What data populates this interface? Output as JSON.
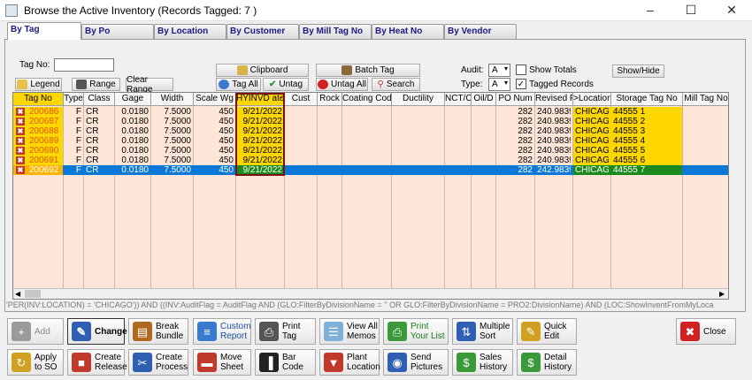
{
  "window": {
    "title": "Browse the Active Inventory  (Records Tagged:  7 )"
  },
  "tabs": [
    "By Tag",
    "By Po",
    "By Location",
    "By Customer",
    "By Mill Tag No",
    "By Heat No",
    "By Vendor"
  ],
  "filters": {
    "tag_no_label": "Tag No:",
    "tag_no_value": "",
    "legend": "Legend",
    "range": "Range",
    "clear_range": "Clear Range",
    "clipboard": "Clipboard",
    "batch_tag": "Batch Tag",
    "tag_all": "Tag All",
    "untag": "Untag",
    "untag_all": "Untag All",
    "search": "Search",
    "audit_label": "Audit:",
    "audit_value": "A",
    "type_label": "Type:",
    "type_value": "A",
    "show_totals": "Show Totals",
    "show_totals_checked": false,
    "tagged_records": "Tagged Records",
    "tagged_records_checked": true,
    "show_hide": "Show/Hide"
  },
  "grid": {
    "columns": [
      "Tag No",
      "Type",
      "Class",
      "Gage",
      "Width",
      "Scale Wg",
      "HYINVD ate",
      "Cust",
      "Rock",
      "Coating Code",
      "Ductility",
      "NCT/C",
      "Oil/D",
      "PO Num",
      "Revised Pr",
      ">Location",
      "Storage Tag No",
      "Mill Tag No"
    ],
    "rows": [
      {
        "tag": "200686",
        "type": "F",
        "class": "CR",
        "gage": "0.0180",
        "width": "7.5000",
        "scale": "450",
        "date": "9/21/2022",
        "po": "282",
        "price": "240.9839",
        "location": "CHICAGO",
        "storage": "44555 1"
      },
      {
        "tag": "200687",
        "type": "F",
        "class": "CR",
        "gage": "0.0180",
        "width": "7.5000",
        "scale": "450",
        "date": "9/21/2022",
        "po": "282",
        "price": "240.9839",
        "location": "CHICAGO",
        "storage": "44555 2"
      },
      {
        "tag": "200688",
        "type": "F",
        "class": "CR",
        "gage": "0.0180",
        "width": "7.5000",
        "scale": "450",
        "date": "9/21/2022",
        "po": "282",
        "price": "240.9839",
        "location": "CHICAGO",
        "storage": "44555 3"
      },
      {
        "tag": "200689",
        "type": "F",
        "class": "CR",
        "gage": "0.0180",
        "width": "7.5000",
        "scale": "450",
        "date": "9/21/2022",
        "po": "282",
        "price": "240.9839",
        "location": "CHICAGO",
        "storage": "44555 4"
      },
      {
        "tag": "200690",
        "type": "F",
        "class": "CR",
        "gage": "0.0180",
        "width": "7.5000",
        "scale": "450",
        "date": "9/21/2022",
        "po": "282",
        "price": "240.9839",
        "location": "CHICAGO",
        "storage": "44555 5"
      },
      {
        "tag": "200691",
        "type": "F",
        "class": "CR",
        "gage": "0.0180",
        "width": "7.5000",
        "scale": "450",
        "date": "9/21/2022",
        "po": "282",
        "price": "240.9839",
        "location": "CHICAGO",
        "storage": "44555 6"
      },
      {
        "tag": "200692",
        "type": "F",
        "class": "CR",
        "gage": "0.0180",
        "width": "7.5000",
        "scale": "450",
        "date": "9/21/2022",
        "po": "282",
        "price": "242.9839",
        "location": "CHICAGO",
        "storage": "44555 7",
        "selected": true
      }
    ]
  },
  "filter_expression": "'PER(INV:LOCATION) = 'CHICAGO')) AND ((INV:AuditFlag = AuditFlag AND (GLO:FilterByDivisionName = '' OR GLO:FilterByDivisionName = PRO2:DivisionName) AND (LOC:ShowInventFromMyLoca",
  "toolbar_row1": [
    {
      "label": "Add",
      "icon": "plus-icon"
    },
    {
      "label": "Change",
      "icon": "pencil-icon"
    },
    {
      "label": "Break Bundle",
      "icon": "break-bundle-icon"
    },
    {
      "label": "Custom Report",
      "icon": "report-icon"
    },
    {
      "label": "Print Tag",
      "icon": "print-icon"
    },
    {
      "label": "View All Memos",
      "icon": "memo-icon"
    },
    {
      "label": "Print Your List",
      "icon": "print-list-icon"
    },
    {
      "label": "Multiple Sort",
      "icon": "sort-icon"
    },
    {
      "label": "Quick Edit",
      "icon": "quick-edit-icon"
    },
    {
      "label": "Close",
      "icon": "close-icon"
    }
  ],
  "toolbar_row2": [
    {
      "label": "Apply to SO",
      "icon": "apply-icon"
    },
    {
      "label": "Create Release",
      "icon": "truck-icon"
    },
    {
      "label": "Create Process",
      "icon": "scissors-icon"
    },
    {
      "label": "Move Sheet",
      "icon": "car-icon"
    },
    {
      "label": "Bar Code",
      "icon": "barcode-icon"
    },
    {
      "label": "Plant Location",
      "icon": "pin-icon"
    },
    {
      "label": "Send Pictures",
      "icon": "camera-icon"
    },
    {
      "label": "Sales History",
      "icon": "money-icon"
    },
    {
      "label": "Detail History",
      "icon": "money-detail-icon"
    }
  ],
  "colors": {
    "tagged_yellow": "#ffd700",
    "selected_blue": "#0a78d7",
    "grid_bg": "#fde6d8",
    "date_highlight_border": "#7a1010",
    "tag_text_orange": "#e05a00"
  }
}
